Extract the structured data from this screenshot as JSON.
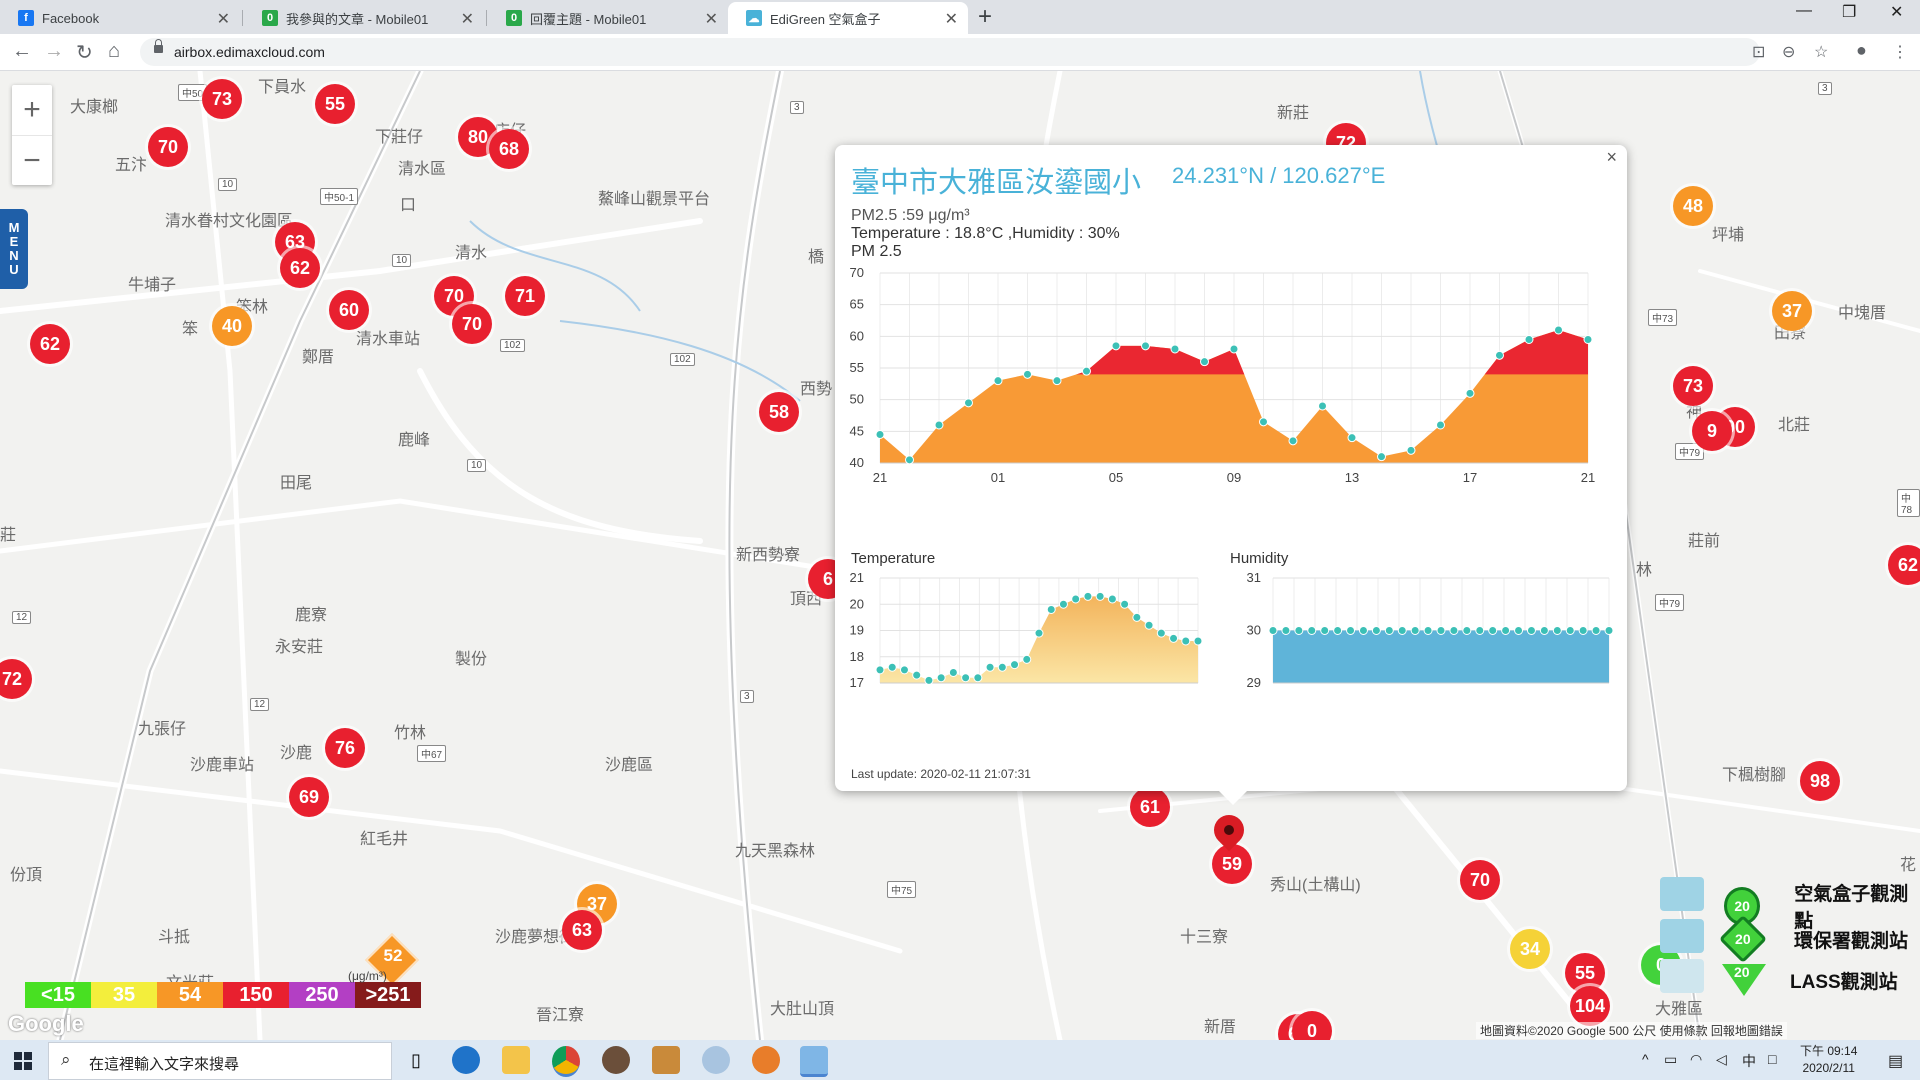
{
  "browser": {
    "tabs": [
      {
        "label": "Facebook",
        "icon": "facebook-icon",
        "color": "#1877f2"
      },
      {
        "label": "我參與的文章 - Mobile01",
        "icon": "mobile01-icon",
        "color": "#2aa84a"
      },
      {
        "label": "回覆主題 - Mobile01",
        "icon": "mobile01-icon",
        "color": "#2aa84a"
      },
      {
        "label": "EdiGreen 空氣盒子",
        "icon": "edigreen-icon",
        "color": "#49b2d8"
      }
    ],
    "new_tab_label": "+",
    "url": "airbox.edimaxcloud.com"
  },
  "map": {
    "zoom_in": "+",
    "zoom_out": "−",
    "menu_label": [
      "M",
      "E",
      "N",
      "U"
    ],
    "places": [
      "大康榔",
      "下員水",
      "五汴",
      "下莊仔",
      "新店仔",
      "清水區",
      "口",
      "清水眷村文化園區",
      "牛埔子",
      "笨林",
      "笨",
      "鄭厝",
      "清水",
      "清水車站",
      "鹿峰",
      "田尾",
      "新西勢寮",
      "頂西",
      "西勢",
      "鹿寮",
      "永安莊",
      "製份",
      "沙鹿",
      "竹林",
      "九張仔",
      "沙鹿車站",
      "紅毛井",
      "沙鹿區",
      "斗抵",
      "文光莊",
      "沙鹿夢想街",
      "晉江寮",
      "份頂",
      "九天黑森林",
      "大肚山頂",
      "十三寮",
      "秀山(土構山)",
      "新厝",
      "大雅區",
      "下楓樹腳",
      "莊前",
      "北莊",
      "中塊厝",
      "田寮",
      "坪埔",
      "新莊",
      "神",
      "林",
      "花",
      "橋",
      "鰲峰山觀景平台",
      "莊"
    ],
    "roads": [
      "中50",
      "中50-1",
      "10",
      "10",
      "102",
      "102",
      "10",
      "12",
      "12",
      "中67",
      "中75",
      "3",
      "3",
      "3",
      "中73",
      "中79",
      "中78",
      "中79"
    ],
    "markers": [
      {
        "v": "73",
        "c": "red"
      },
      {
        "v": "55",
        "c": "red"
      },
      {
        "v": "70",
        "c": "red"
      },
      {
        "v": "80",
        "c": "red"
      },
      {
        "v": "68",
        "c": "red"
      },
      {
        "v": "63",
        "c": "red"
      },
      {
        "v": "62",
        "c": "red"
      },
      {
        "v": "40",
        "c": "orange"
      },
      {
        "v": "60",
        "c": "red"
      },
      {
        "v": "70",
        "c": "red"
      },
      {
        "v": "70",
        "c": "red"
      },
      {
        "v": "71",
        "c": "red"
      },
      {
        "v": "62",
        "c": "red"
      },
      {
        "v": "58",
        "c": "red"
      },
      {
        "v": "72",
        "c": "red"
      },
      {
        "v": "76",
        "c": "red"
      },
      {
        "v": "69",
        "c": "red"
      },
      {
        "v": "37",
        "c": "orange"
      },
      {
        "v": "63",
        "c": "red"
      },
      {
        "v": "61",
        "c": "red"
      },
      {
        "v": "59",
        "c": "red"
      },
      {
        "v": "70",
        "c": "red"
      },
      {
        "v": "34",
        "c": "yellow"
      },
      {
        "v": "55",
        "c": "red"
      },
      {
        "v": "104",
        "c": "red"
      },
      {
        "v": "64",
        "c": "red"
      },
      {
        "v": "0",
        "c": "green"
      },
      {
        "v": "48",
        "c": "orange"
      },
      {
        "v": "37",
        "c": "orange"
      },
      {
        "v": "73",
        "c": "red"
      },
      {
        "v": "90",
        "c": "red"
      },
      {
        "v": "9",
        "c": "red"
      },
      {
        "v": "62",
        "c": "red"
      },
      {
        "v": "98",
        "c": "red"
      },
      {
        "v": "72",
        "c": "red"
      },
      {
        "v": "6",
        "c": "red"
      },
      {
        "v": "0",
        "c": "red"
      }
    ],
    "epa_marker_value": "52",
    "legend_scale": [
      {
        "label": "<15",
        "color": "#48e022"
      },
      {
        "label": "35",
        "color": "#f3ee3c"
      },
      {
        "label": "54",
        "color": "#f79726"
      },
      {
        "label": "150",
        "color": "#e8202f"
      },
      {
        "label": "250",
        "color": "#b33fc4"
      },
      {
        "label": ">251",
        "color": "#851b1b"
      }
    ],
    "legend_unit": "(μg/m³)",
    "station_legend": [
      {
        "label": "空氣盒子觀測點",
        "value": "20"
      },
      {
        "label": "環保署觀測站",
        "value": "20"
      },
      {
        "label": "LASS觀測站",
        "value": "20"
      }
    ],
    "google_logo": "Google",
    "attribution": "地圖資料©2020 Google   500 公尺          使用條款   回報地圖錯誤"
  },
  "popup": {
    "close": "×",
    "title": "臺中市大雅區汝鎏國小",
    "coord": "24.231°N / 120.627°E",
    "pm_line": "PM2.5 :59 μg/m³",
    "env_line": "Temperature : 18.8°C ,Humidity : 30%",
    "pm_chart_title": "PM 2.5",
    "temp_chart_title": "Temperature",
    "hum_chart_title": "Humidity",
    "last_update": "Last update: 2020-02-11 21:07:31"
  },
  "chart_data": [
    {
      "type": "area",
      "title": "PM 2.5",
      "ylim": [
        40,
        70
      ],
      "yticks": [
        40,
        45,
        50,
        55,
        60,
        65,
        70
      ],
      "xticks": [
        "21",
        "01",
        "05",
        "09",
        "13",
        "17",
        "21"
      ],
      "threshold": 54,
      "values": [
        44.5,
        40.5,
        46,
        49.5,
        53,
        54,
        53,
        54.5,
        58.5,
        58.5,
        58,
        56,
        58,
        46.5,
        43.5,
        49,
        44,
        41,
        42,
        46,
        51,
        57,
        59.5,
        61,
        59.5
      ],
      "grid": true
    },
    {
      "type": "area",
      "title": "Temperature",
      "ylim": [
        17,
        21
      ],
      "yticks": [
        17,
        18,
        19,
        20,
        21
      ],
      "values": [
        17.5,
        17.6,
        17.5,
        17.3,
        17.1,
        17.2,
        17.4,
        17.2,
        17.2,
        17.6,
        17.6,
        17.7,
        17.9,
        18.9,
        19.8,
        20.0,
        20.2,
        20.3,
        20.3,
        20.2,
        20.0,
        19.5,
        19.2,
        18.9,
        18.7,
        18.6,
        18.6
      ],
      "grid": true
    },
    {
      "type": "area",
      "title": "Humidity",
      "ylim": [
        29,
        31
      ],
      "yticks": [
        29,
        30,
        31
      ],
      "values": [
        30,
        30,
        30,
        30,
        30,
        30,
        30,
        30,
        30,
        30,
        30,
        30,
        30,
        30,
        30,
        30,
        30,
        30,
        30,
        30,
        30,
        30,
        30,
        30,
        30,
        30,
        30
      ],
      "grid": true
    }
  ],
  "taskbar": {
    "search_placeholder": "在這裡輸入文字來搜尋",
    "ime": "中",
    "time": "下午 09:14",
    "date": "2020/2/11"
  }
}
